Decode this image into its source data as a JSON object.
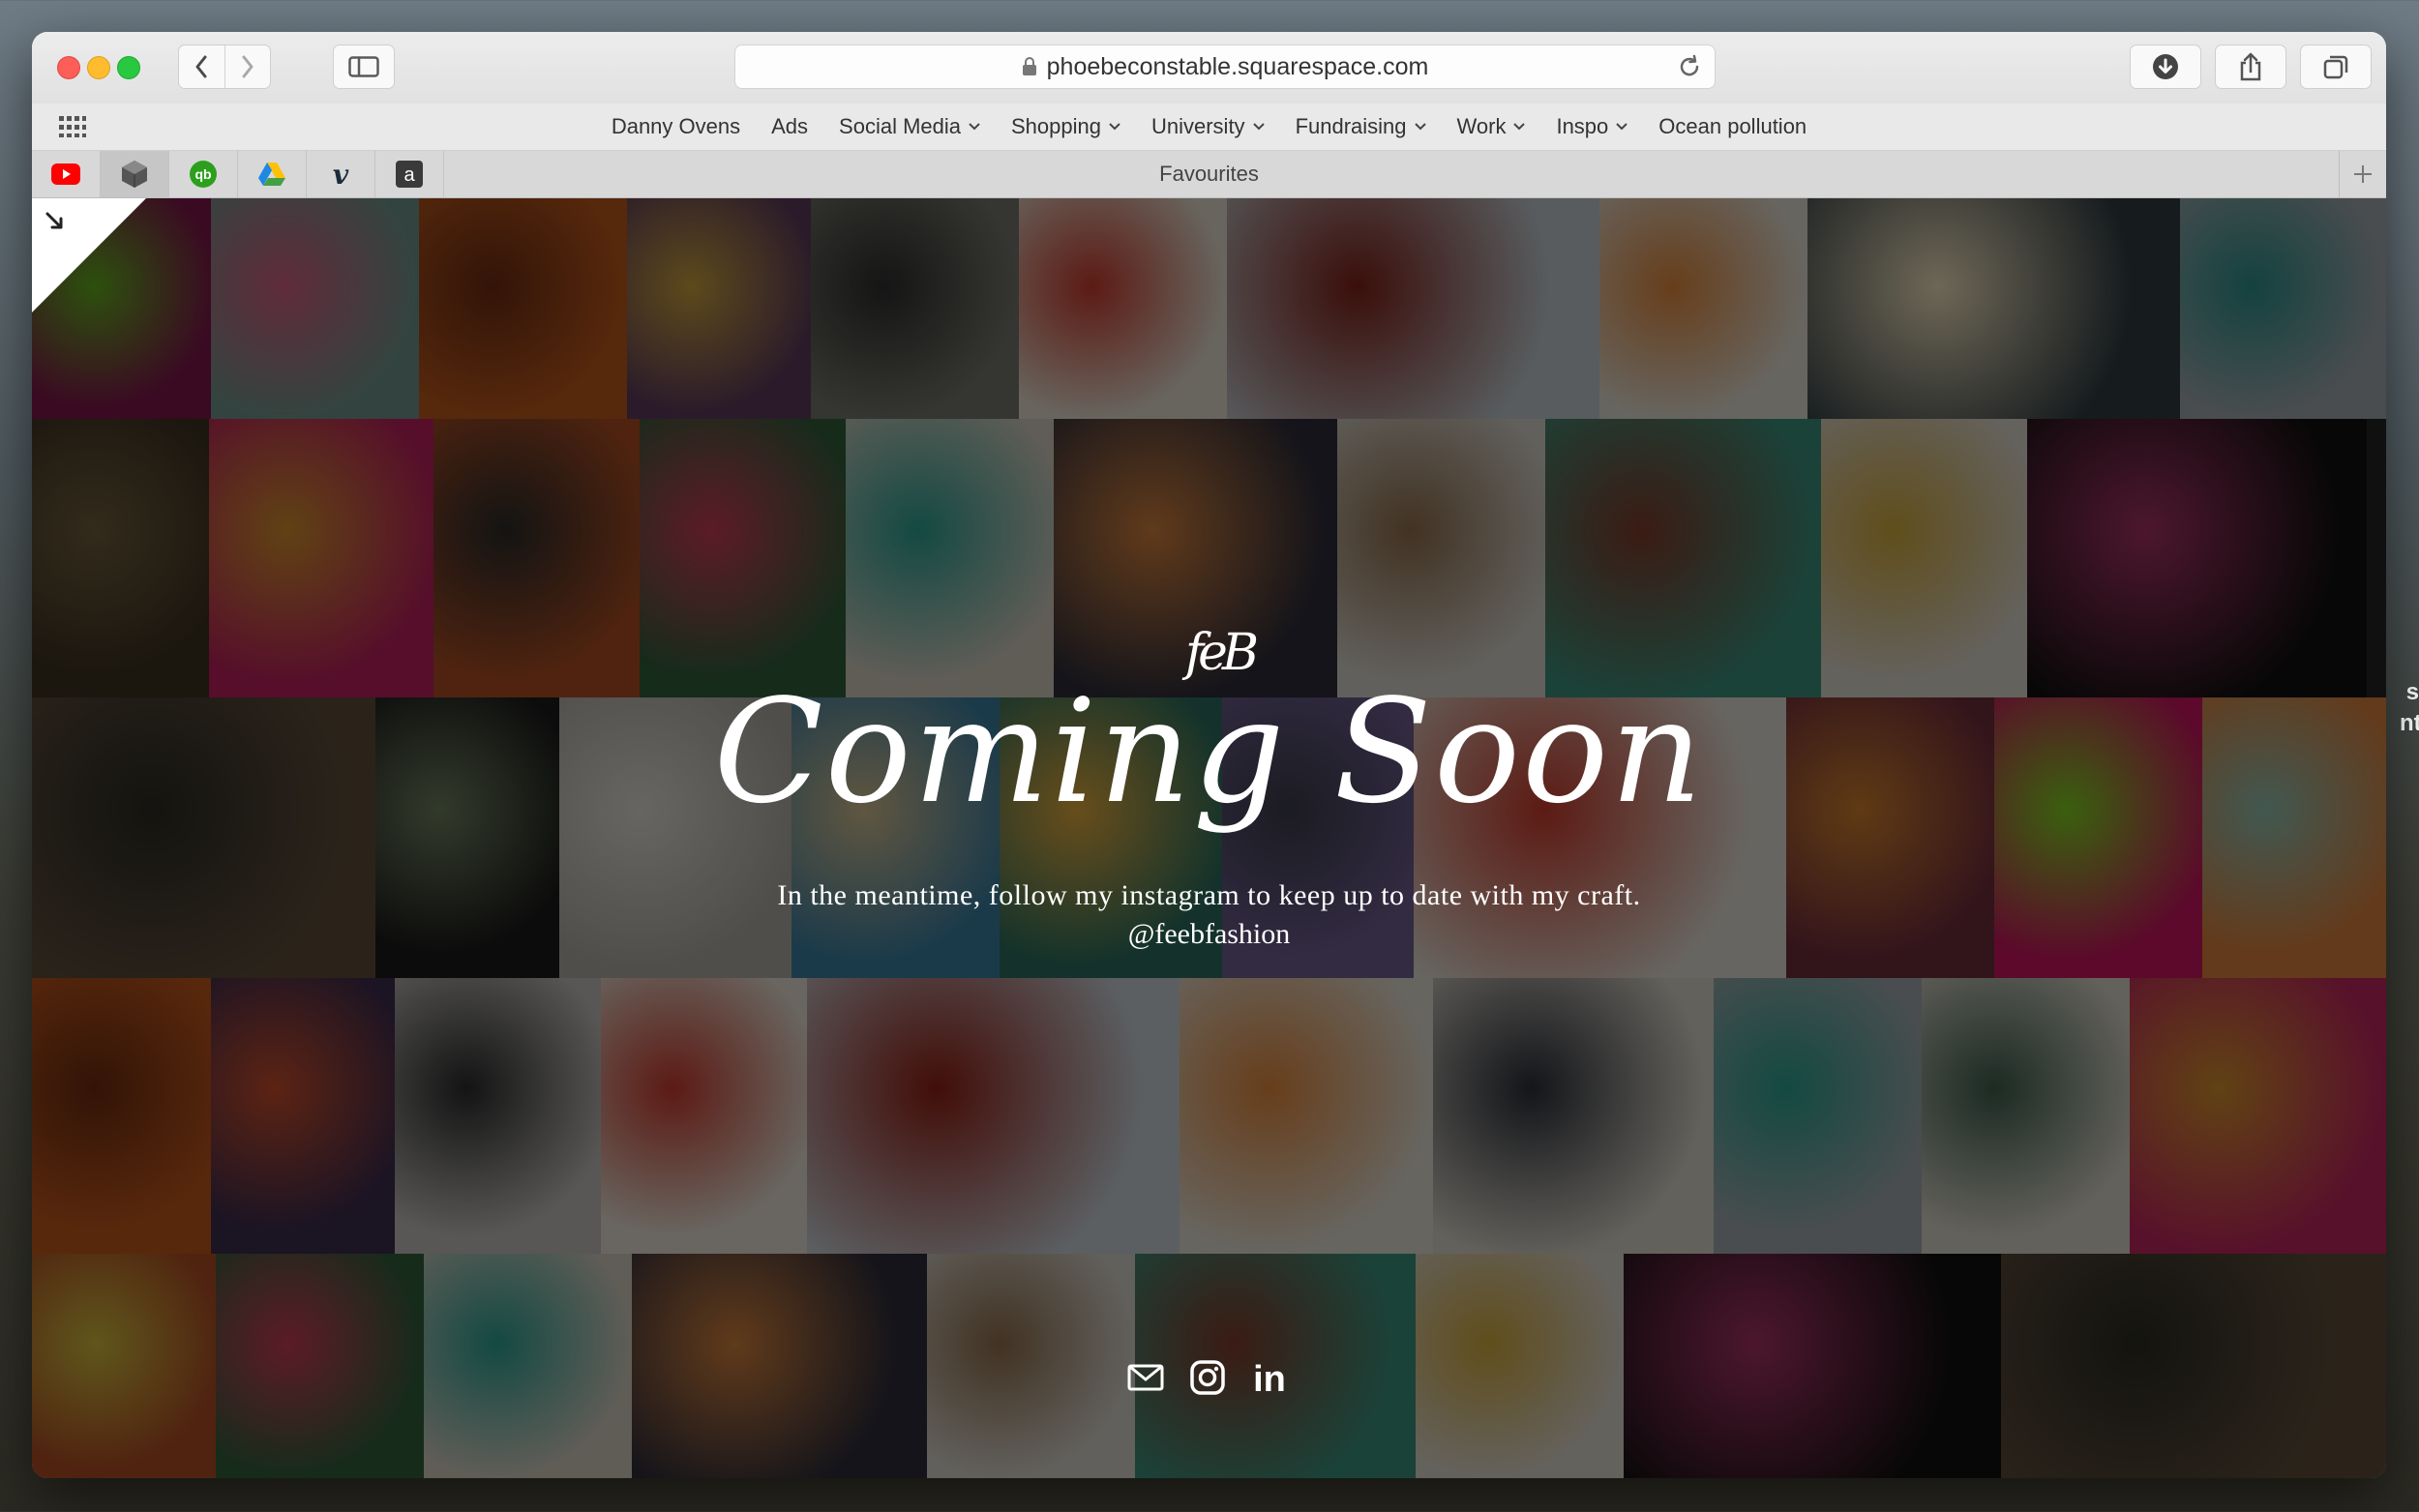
{
  "browser": {
    "url": "phoebeconstable.squarespace.com"
  },
  "bookmarks": [
    {
      "label": "Danny Ovens",
      "has_menu": false
    },
    {
      "label": "Ads",
      "has_menu": false
    },
    {
      "label": "Social Media",
      "has_menu": true
    },
    {
      "label": "Shopping",
      "has_menu": true
    },
    {
      "label": "University",
      "has_menu": true
    },
    {
      "label": "Fundraising",
      "has_menu": true
    },
    {
      "label": "Work",
      "has_menu": true
    },
    {
      "label": "Inspo",
      "has_menu": true
    },
    {
      "label": "Ocean pollution",
      "has_menu": false
    }
  ],
  "favourites": {
    "title": "Favourites",
    "icons": [
      "youtube-icon",
      "cube-icon",
      "quickbooks-icon",
      "google-drive-icon",
      "vimeo-icon",
      "a-icon"
    ],
    "icon_glyphs": {
      "quickbooks": "qb",
      "vimeo": "v",
      "a": "a"
    }
  },
  "page": {
    "logo": "feB",
    "title": "Coming Soon",
    "subtitle": "In the meantime, follow my instagram to keep up to date with my craft.",
    "handle": "@feebfashion",
    "social_icons": [
      "email-icon",
      "instagram-icon",
      "linkedin-icon"
    ],
    "social_glyphs": {
      "linkedin": "in"
    }
  },
  "desktop_edge_text": [
    "s",
    "nt"
  ],
  "colors": {
    "traffic_red": "#fd5e57",
    "traffic_yellow": "#febc2e",
    "traffic_green": "#28c840"
  }
}
